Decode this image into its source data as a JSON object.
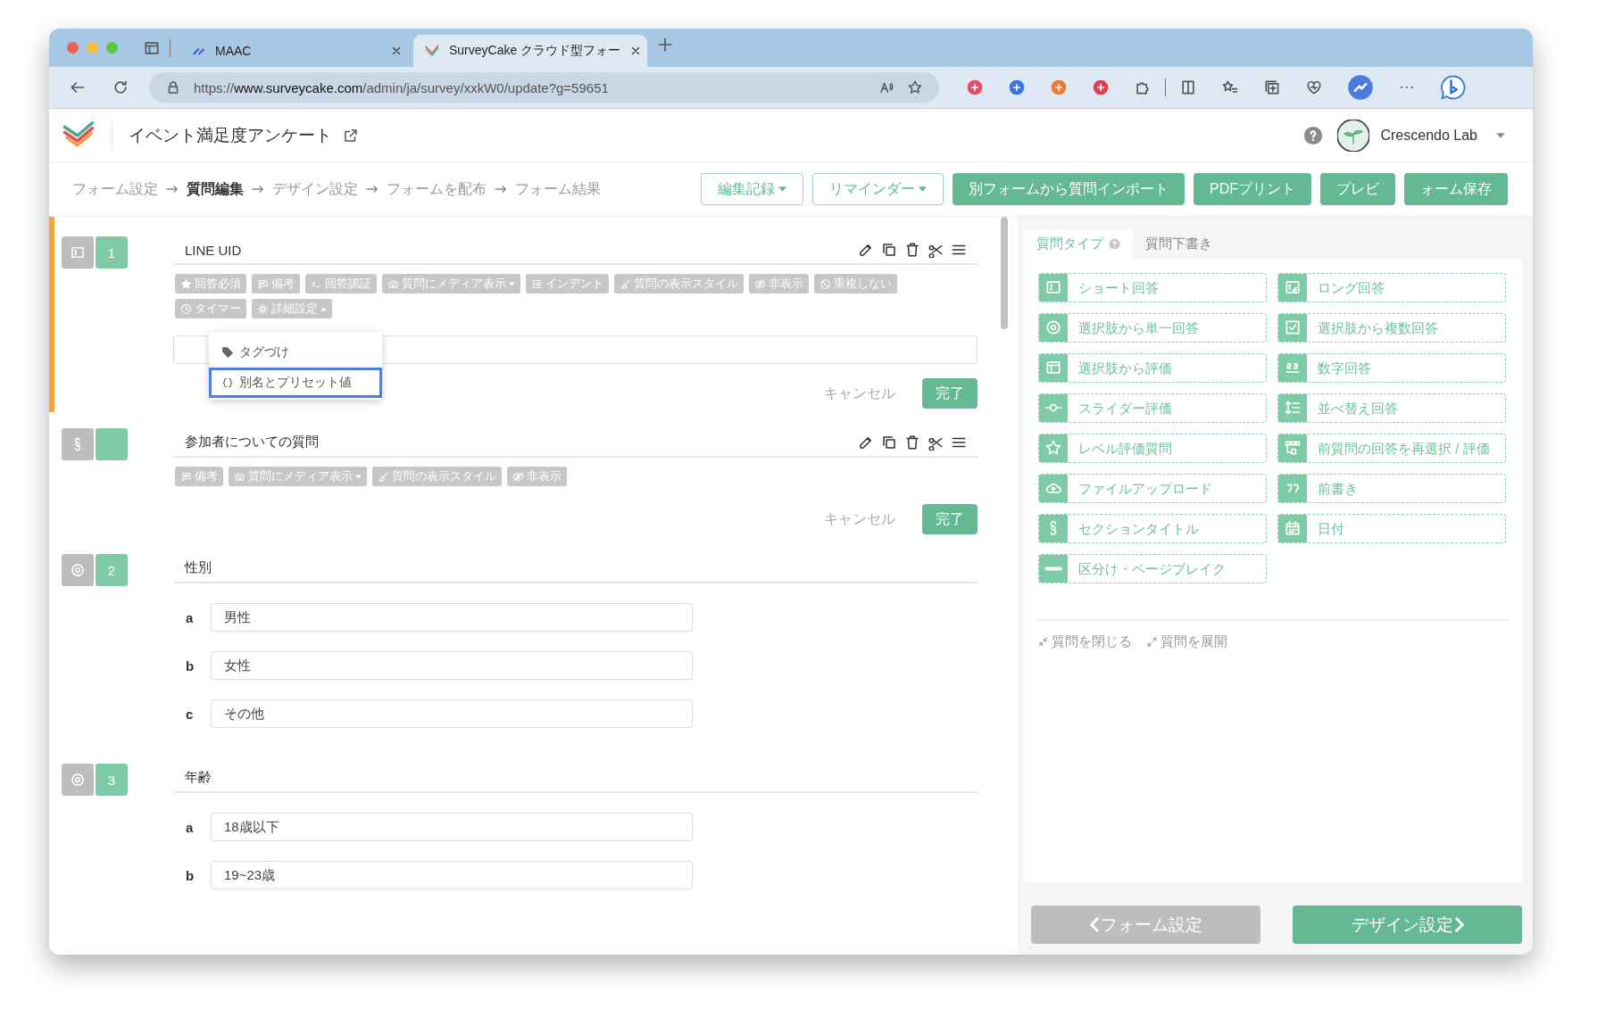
{
  "browser": {
    "tabs": [
      {
        "title": "MAAC",
        "selected": false
      },
      {
        "title": "SurveyCake クラウド型フォー",
        "selected": true
      }
    ],
    "url": {
      "scheme": "https://",
      "host": "www.surveycake.com",
      "path": "/admin/ja/survey/xxkW0/update?g=59651"
    }
  },
  "header": {
    "title": "イベント満足度アンケート",
    "user": "Crescendo Lab"
  },
  "steps": [
    {
      "label": "フォーム設定",
      "selected": false
    },
    {
      "label": "質問編集",
      "selected": true
    },
    {
      "label": "デザイン設定",
      "selected": false
    },
    {
      "label": "フォームを配布",
      "selected": false
    },
    {
      "label": "フォーム結果",
      "selected": false
    }
  ],
  "actions": [
    {
      "label": "編集記録",
      "kind": "outline",
      "dropdown": true
    },
    {
      "label": "リマインダー",
      "kind": "outline",
      "dropdown": true
    },
    {
      "label": "別フォームから質問インポート",
      "kind": "solid"
    },
    {
      "label": "PDFプリント",
      "kind": "solid"
    },
    {
      "label": "プレビ",
      "kind": "solid"
    },
    {
      "label": "ォーム保存",
      "kind": "solid"
    }
  ],
  "questions": [
    {
      "kind": "text",
      "number": "1",
      "title": "LINE UID",
      "active": true,
      "tags": [
        {
          "label": "回答必須",
          "kind": "star"
        },
        {
          "label": "備考",
          "kind": "comment"
        },
        {
          "label": "回答認証",
          "kind": "terminal"
        },
        {
          "label": "質問にメディア表示",
          "kind": "camera",
          "expanded": false
        },
        {
          "label": "インデント",
          "kind": "indent"
        },
        {
          "label": "質問の表示スタイル",
          "kind": "brush"
        },
        {
          "label": "非表示",
          "kind": "eyeslash"
        },
        {
          "label": "重複しない",
          "kind": "ban"
        },
        {
          "label": "タイマー",
          "kind": "clock"
        },
        {
          "label": "詳細設定",
          "kind": "gear",
          "expanded": true
        }
      ],
      "menu": [
        {
          "label": "タグづけ",
          "kind": "tag",
          "selected": false
        },
        {
          "label": "別名とプリセット値",
          "kind": "braces",
          "selected": true
        }
      ],
      "cancel": "キャンセル",
      "done": "完了"
    },
    {
      "kind": "section",
      "title": "参加者についての質問",
      "active": false,
      "tags": [
        {
          "label": "備考",
          "kind": "comment"
        },
        {
          "label": "質問にメディア表示",
          "kind": "camera",
          "expanded": false
        },
        {
          "label": "質問の表示スタイル",
          "kind": "brush"
        },
        {
          "label": "非表示",
          "kind": "eyeslash"
        }
      ],
      "cancel": "キャンセル",
      "done": "完了"
    },
    {
      "kind": "choice",
      "number": "2",
      "title": "性別",
      "active": false,
      "options": [
        {
          "letter": "a",
          "value": "男性"
        },
        {
          "letter": "b",
          "value": "女性"
        },
        {
          "letter": "c",
          "value": "その他"
        }
      ]
    },
    {
      "kind": "choice",
      "number": "3",
      "title": "年齢",
      "active": false,
      "options": [
        {
          "letter": "a",
          "value": "18歳以下"
        },
        {
          "letter": "b",
          "value": "19~23歳"
        }
      ]
    }
  ],
  "panel": {
    "tabs": [
      {
        "label": "質問タイプ",
        "selected": true,
        "help": true
      },
      {
        "label": "質問下書き",
        "selected": false
      }
    ],
    "types": [
      {
        "label": "ショート回答",
        "kind": "short"
      },
      {
        "label": "ロング回答",
        "kind": "long"
      },
      {
        "label": "選択肢から単一回答",
        "kind": "radio"
      },
      {
        "label": "選択肢から複数回答",
        "kind": "checkbox"
      },
      {
        "label": "選択肢から評価",
        "kind": "matrix"
      },
      {
        "label": "数字回答",
        "kind": "number"
      },
      {
        "label": "スライダー評価",
        "kind": "slider"
      },
      {
        "label": "並べ替え回答",
        "kind": "sort"
      },
      {
        "label": "レベル評価質問",
        "kind": "star"
      },
      {
        "label": "前質問の回答を再選択 / 評価",
        "kind": "prev"
      },
      {
        "label": "ファイルアップロード",
        "kind": "upload"
      },
      {
        "label": "前書き",
        "kind": "quote"
      },
      {
        "label": "セクションタイトル",
        "kind": "section"
      },
      {
        "label": "日付",
        "kind": "date"
      },
      {
        "label": "区分け・ページブレイク",
        "kind": "divider"
      }
    ],
    "collapse": "質問を閉じる",
    "expand": "質問を展開",
    "back": "フォーム設定",
    "next": "デザイン設定"
  }
}
